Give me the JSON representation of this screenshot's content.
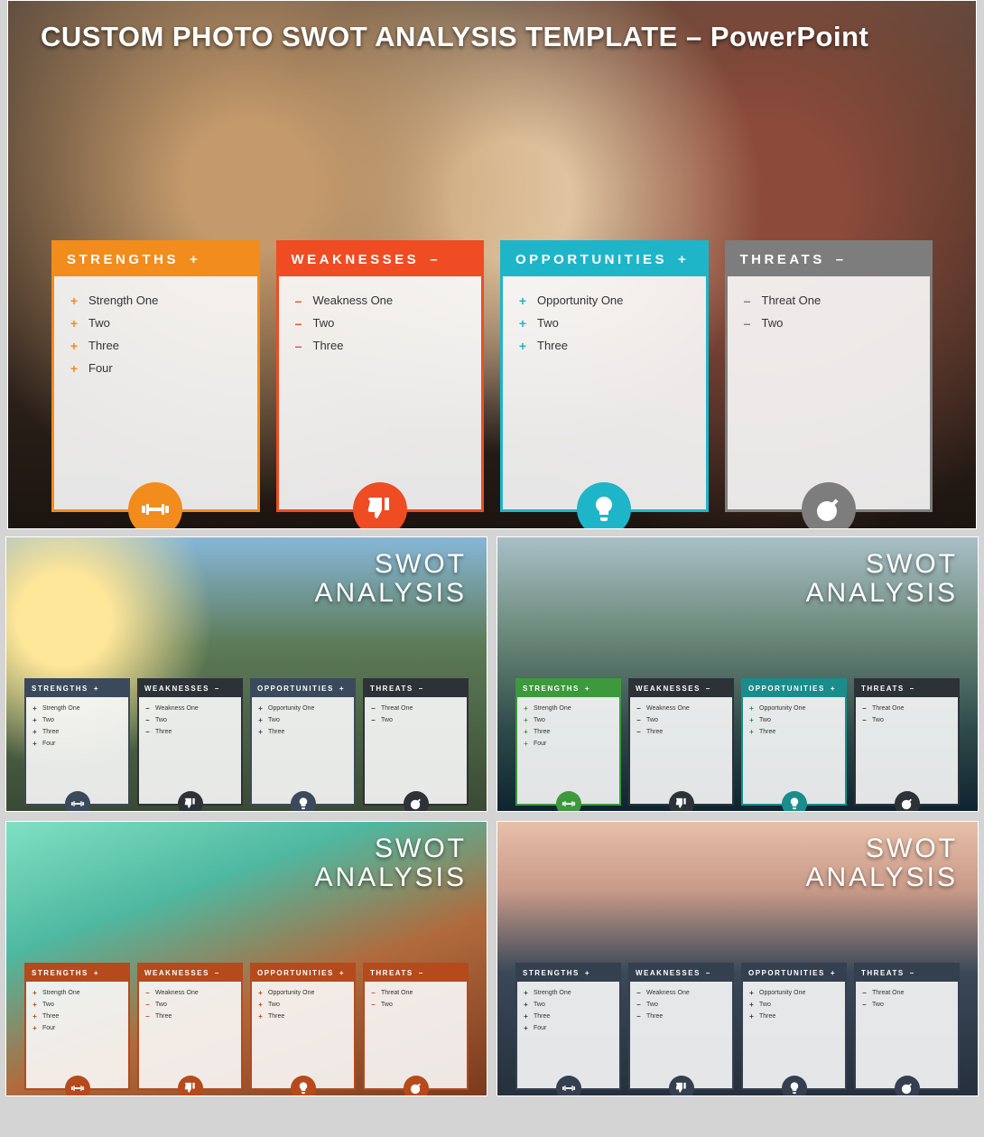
{
  "hero": {
    "title": "CUSTOM PHOTO SWOT ANALYSIS TEMPLATE  –  PowerPoint",
    "cards": [
      {
        "key": "strengths",
        "label": "STRENGTHS",
        "sign": "+",
        "theme": "c-orange",
        "icon": "dumbbell",
        "items": [
          "Strength One",
          "Two",
          "Three",
          "Four"
        ]
      },
      {
        "key": "weaknesses",
        "label": "WEAKNESSES",
        "sign": "–",
        "theme": "c-red",
        "icon": "thumbdown",
        "items": [
          "Weakness One",
          "Two",
          "Three"
        ]
      },
      {
        "key": "opportunities",
        "label": "OPPORTUNITIES",
        "sign": "+",
        "theme": "c-teal",
        "icon": "bulb",
        "items": [
          "Opportunity One",
          "Two",
          "Three"
        ]
      },
      {
        "key": "threats",
        "label": "THREATS",
        "sign": "–",
        "theme": "c-gray",
        "icon": "bomb",
        "items": [
          "Threat One",
          "Two"
        ]
      }
    ]
  },
  "thumbTitle": {
    "line1": "SWOT",
    "line2": "ANALYSIS"
  },
  "thumbs": [
    {
      "bg": "bg1",
      "cards": [
        {
          "label": "STRENGTHS",
          "sign": "+",
          "theme": "a-slate",
          "icon": "dumbbell",
          "items": [
            "Strength One",
            "Two",
            "Three",
            "Four"
          ]
        },
        {
          "label": "WEAKNESSES",
          "sign": "–",
          "theme": "a-dark",
          "icon": "thumbdown",
          "items": [
            "Weakness One",
            "Two",
            "Three"
          ]
        },
        {
          "label": "OPPORTUNITIES",
          "sign": "+",
          "theme": "a-slate",
          "icon": "bulb",
          "items": [
            "Opportunity One",
            "Two",
            "Three"
          ]
        },
        {
          "label": "THREATS",
          "sign": "–",
          "theme": "a-dark",
          "icon": "bomb",
          "items": [
            "Threat One",
            "Two"
          ]
        }
      ]
    },
    {
      "bg": "bg2",
      "cards": [
        {
          "label": "STRENGTHS",
          "sign": "+",
          "theme": "a-green",
          "icon": "dumbbell",
          "items": [
            "Strength One",
            "Two",
            "Three",
            "Four"
          ]
        },
        {
          "label": "WEAKNESSES",
          "sign": "–",
          "theme": "a-dark",
          "icon": "thumbdown",
          "items": [
            "Weakness One",
            "Two",
            "Three"
          ]
        },
        {
          "label": "OPPORTUNITIES",
          "sign": "+",
          "theme": "a-teal2",
          "icon": "bulb",
          "items": [
            "Opportunity One",
            "Two",
            "Three"
          ]
        },
        {
          "label": "THREATS",
          "sign": "–",
          "theme": "a-dark",
          "icon": "bomb",
          "items": [
            "Threat One",
            "Two"
          ]
        }
      ]
    },
    {
      "bg": "bg3",
      "cards": [
        {
          "label": "STRENGTHS",
          "sign": "+",
          "theme": "a-rust",
          "icon": "dumbbell",
          "items": [
            "Strength One",
            "Two",
            "Three",
            "Four"
          ]
        },
        {
          "label": "WEAKNESSES",
          "sign": "–",
          "theme": "a-rust",
          "icon": "thumbdown",
          "items": [
            "Weakness One",
            "Two",
            "Three"
          ]
        },
        {
          "label": "OPPORTUNITIES",
          "sign": "+",
          "theme": "a-rust",
          "icon": "bulb",
          "items": [
            "Opportunity One",
            "Two",
            "Three"
          ]
        },
        {
          "label": "THREATS",
          "sign": "–",
          "theme": "a-rust",
          "icon": "bomb",
          "items": [
            "Threat One",
            "Two"
          ]
        }
      ]
    },
    {
      "bg": "bg4",
      "cards": [
        {
          "label": "STRENGTHS",
          "sign": "+",
          "theme": "a-navy",
          "icon": "dumbbell",
          "items": [
            "Strength One",
            "Two",
            "Three",
            "Four"
          ]
        },
        {
          "label": "WEAKNESSES",
          "sign": "–",
          "theme": "a-navy",
          "icon": "thumbdown",
          "items": [
            "Weakness One",
            "Two",
            "Three"
          ]
        },
        {
          "label": "OPPORTUNITIES",
          "sign": "+",
          "theme": "a-navy",
          "icon": "bulb",
          "items": [
            "Opportunity One",
            "Two",
            "Three"
          ]
        },
        {
          "label": "THREATS",
          "sign": "–",
          "theme": "a-navy",
          "icon": "bomb",
          "items": [
            "Threat One",
            "Two"
          ]
        }
      ]
    }
  ]
}
